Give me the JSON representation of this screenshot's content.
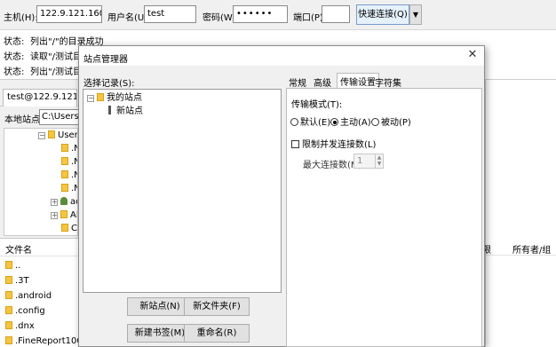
{
  "quickconnect": {
    "host_label": "主机(H):",
    "host_value": "122.9.121.160",
    "user_label": "用户名(U):",
    "user_value": "test",
    "pass_label": "密码(W):",
    "pass_value": "••••••",
    "port_label": "端口(P):",
    "port_value": "",
    "connect_label": "快速连接(Q)",
    "dropdown_glyph": "▼"
  },
  "log": [
    {
      "key": "状态:",
      "text": "列出\"/\"的目录成功"
    },
    {
      "key": "状态:",
      "text": "读取\"/测试目录"
    },
    {
      "key": "状态:",
      "text": "列出\"/测试目录"
    }
  ],
  "tabs": {
    "site_tab": "test@122.9.121.160"
  },
  "local": {
    "site_label": "本地站点:",
    "path_value": "C:\\Users\\ad",
    "tree": [
      {
        "label": "Users",
        "type": "folder-expanded"
      },
      {
        "label": ".N",
        "type": "folder"
      },
      {
        "label": ".N",
        "type": "folder"
      },
      {
        "label": ".N",
        "type": "folder"
      },
      {
        "label": ".N",
        "type": "folder"
      },
      {
        "label": "ad",
        "type": "user"
      },
      {
        "label": "Al",
        "type": "folder"
      },
      {
        "label": "Cl",
        "type": "folder"
      }
    ],
    "file_header": "文件名",
    "files": [
      "..",
      ".3T",
      ".android",
      ".config",
      ".dnx",
      ".FineReport100"
    ]
  },
  "remote": {
    "col_a": "限",
    "col_b": "所有者/组"
  },
  "site_manager": {
    "title": "站点管理器",
    "close_glyph": "✕",
    "select_label": "选择记录(S):",
    "tree": {
      "root": "我的站点",
      "child": "新站点",
      "expander": "⊟"
    },
    "buttons": {
      "new_site": "新站点(N)",
      "new_folder": "新文件夹(F)",
      "new_bookmark": "新建书签(M)",
      "rename": "重命名(R)"
    },
    "tabs": [
      "常规",
      "高级",
      "传输设置",
      "字符集"
    ],
    "active_tab": "传输设置",
    "transfer": {
      "mode_label": "传输模式(T):",
      "modes": [
        "默认(E)",
        "主动(A)",
        "被动(P)"
      ],
      "selected_mode": "主动(A)",
      "limit_label": "限制并发连接数(L)",
      "limit_checked": false,
      "max_label": "最大连接数(M):",
      "max_value": "1"
    }
  },
  "colors": {
    "folder": "#f5c542",
    "accent_button": "#e5f1fb",
    "accent_border": "#7a9cc9"
  }
}
